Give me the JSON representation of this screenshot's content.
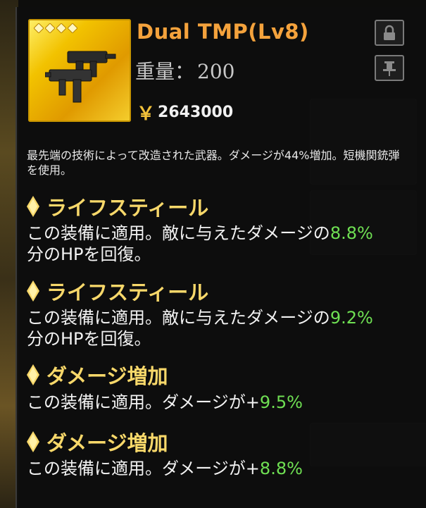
{
  "item": {
    "name": "Dual TMP(Lv8)",
    "weight_label": "重量：",
    "weight_value": "200",
    "currency_symbol": "￥",
    "price": "2643000",
    "rarity_stars": 4,
    "description": "最先端の技術によって改造された武器。ダメージが44%増加。短機関銃弾を使用。"
  },
  "buttons": {
    "lock_icon": "lock-icon",
    "pin_icon": "pin-icon"
  },
  "perks": [
    {
      "title": "ライフスティール",
      "text_before": "この装備に適用。敵に与えたダメージの",
      "value": "8.8%",
      "text_after": "分のHPを回復。"
    },
    {
      "title": "ライフスティール",
      "text_before": "この装備に適用。敵に与えたダメージの",
      "value": "9.2%",
      "text_after": "分のHPを回復。"
    },
    {
      "title": "ダメージ増加",
      "text_before": "この装備に適用。ダメージが+",
      "value": "9.5%",
      "text_after": ""
    },
    {
      "title": "ダメージ増加",
      "text_before": "この装備に適用。ダメージが+",
      "value": "8.8%",
      "text_after": ""
    }
  ],
  "colors": {
    "title": "#f4a23c",
    "perk_title": "#f8d86a",
    "percent": "#6fe053",
    "panel": "#0e0e0e"
  }
}
